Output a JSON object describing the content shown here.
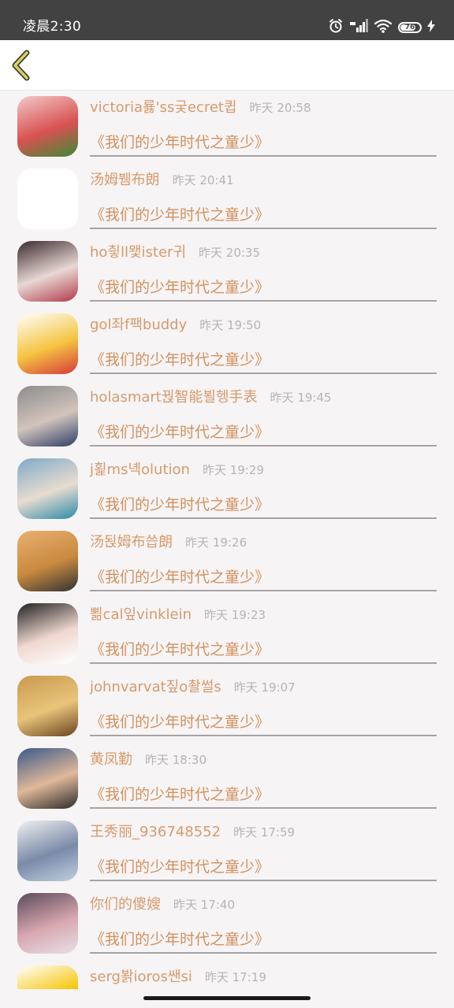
{
  "status_bar": {
    "time": "凌晨2:30",
    "battery_level": "76"
  },
  "header": {
    "back_icon": "chevron-left-icon"
  },
  "list": {
    "items": [
      {
        "name": "victoria룛'ss궂ecret큅",
        "time": "昨天 20:58",
        "title": "《我们的少年时代之童少》",
        "avatar_colors": [
          "#f2c8c8",
          "#d95252",
          "#3f8a35"
        ]
      },
      {
        "name": "汤姆뷈布朗",
        "time": "昨天 20:41",
        "title": "《我们的少年时代之童少》",
        "avatar_colors": [
          "#ffffff",
          "#ffffff",
          "#ffffff"
        ]
      },
      {
        "name": "ho칗ll뫷ister귀",
        "time": "昨天 20:35",
        "title": "《我们的少年时代之童少》",
        "avatar_colors": [
          "#3a2a2e",
          "#e8d8d4",
          "#b23a48"
        ]
      },
      {
        "name": "gol좌f팩buddy",
        "time": "昨天 19:50",
        "title": "《我们的少年时代之童少》",
        "avatar_colors": [
          "#ffffff",
          "#f5c542",
          "#d63a3a"
        ]
      },
      {
        "name": "holasmart꿙智能뵐헹手表",
        "time": "昨天 19:45",
        "title": "《我们的少年时代之童少》",
        "avatar_colors": [
          "#8c8c8c",
          "#d2c4bc",
          "#2e3e66"
        ]
      },
      {
        "name": "j횙ms녝olution",
        "time": "昨天 19:29",
        "title": "《我们的少年时代之童少》",
        "avatar_colors": [
          "#7fa9c9",
          "#e8dcd0",
          "#2b8aa8"
        ]
      },
      {
        "name": "汤됝姆布씁朗",
        "time": "昨天 19:26",
        "title": "《我们的少年时代之童少》",
        "avatar_colors": [
          "#e8b070",
          "#c98a40",
          "#333333"
        ]
      },
      {
        "name": "뾞cal잎vinklein",
        "time": "昨天 19:23",
        "title": "《我们的少年时代之童少》",
        "avatar_colors": [
          "#202020",
          "#f0d8d0",
          "#ffffff"
        ]
      },
      {
        "name": "johnvarvat짚o촬썰s",
        "time": "昨天 19:07",
        "title": "《我们的少年时代之童少》",
        "avatar_colors": [
          "#c89a50",
          "#e8c47a",
          "#6a4420"
        ]
      },
      {
        "name": "黄凤勤",
        "time": "昨天 18:30",
        "title": "《我们的少年时代之童少》",
        "avatar_colors": [
          "#3a5a8a",
          "#e0b89a",
          "#2a2a2a"
        ]
      },
      {
        "name": "王秀丽_936748552",
        "time": "昨天 17:59",
        "title": "《我们的少年时代之童少》",
        "avatar_colors": [
          "#f0f0f0",
          "#7a8aa8",
          "#c0d0e0"
        ]
      },
      {
        "name": "你们的傻嫂",
        "time": "昨天 17:40",
        "title": "《我们的少年时代之童少》",
        "avatar_colors": [
          "#5a4a5a",
          "#d8a8b0",
          "#e8e0e8"
        ]
      },
      {
        "name": "serg봙ioros쌘si",
        "time": "昨天 17:19",
        "title": "",
        "avatar_colors": [
          "#ffffff",
          "#f5c400",
          "#d83030"
        ]
      }
    ]
  },
  "colors": {
    "accent": "#d2915e",
    "time_gray": "#b8b3b5",
    "background": "#f7f4f5",
    "status_bar": "#424242"
  }
}
